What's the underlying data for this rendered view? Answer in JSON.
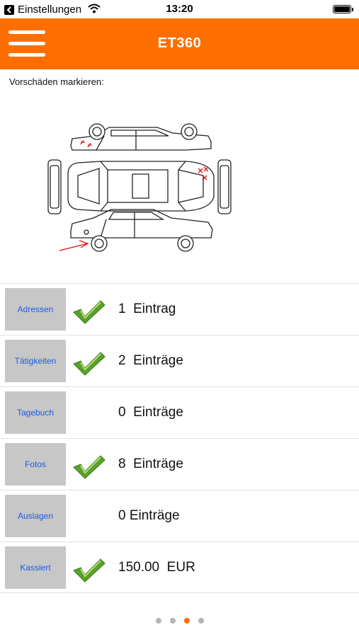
{
  "status_bar": {
    "back_label": "Einstellungen",
    "time": "13:20"
  },
  "nav": {
    "title": "ET360",
    "brand_color": "#ff6f00"
  },
  "damage": {
    "label": "Vorschäden markieren:"
  },
  "rows": [
    {
      "button": "Adressen",
      "value": "1  Eintrag",
      "checked": true
    },
    {
      "button": "Tätigkeiten",
      "value": "2  Einträge",
      "checked": true
    },
    {
      "button": "Tagebuch",
      "value": "0  Einträge",
      "checked": false
    },
    {
      "button": "Fotos",
      "value": "8  Einträge",
      "checked": true
    },
    {
      "button": "Auslagen",
      "value": "0 Einträge",
      "checked": false
    },
    {
      "button": "Kassiert",
      "value": "150.00  EUR",
      "checked": true
    }
  ],
  "pager": {
    "pages": 4,
    "active_index": 2
  }
}
